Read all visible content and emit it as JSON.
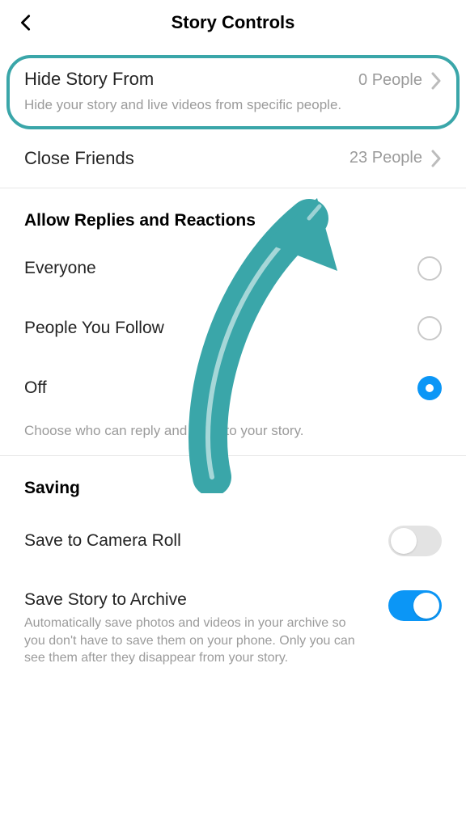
{
  "header": {
    "title": "Story Controls"
  },
  "hide_story": {
    "title": "Hide Story From",
    "value": "0 People",
    "subtitle": "Hide your story and live videos from specific people."
  },
  "close_friends": {
    "title": "Close Friends",
    "value": "23 People"
  },
  "replies": {
    "header": "Allow Replies and Reactions",
    "options": [
      {
        "label": "Everyone",
        "selected": false
      },
      {
        "label": "People You Follow",
        "selected": false
      },
      {
        "label": "Off",
        "selected": true
      }
    ],
    "help": "Choose who can reply and react to your story."
  },
  "saving": {
    "header": "Saving",
    "camera_roll": {
      "title": "Save to Camera Roll",
      "on": false
    },
    "archive": {
      "title": "Save Story to Archive",
      "subtitle": "Automatically save photos and videos in your archive so you don't have to save them on your phone. Only you can see them after they disappear from your story.",
      "on": true
    }
  },
  "annotation": {
    "color": "#3aa6a9"
  }
}
